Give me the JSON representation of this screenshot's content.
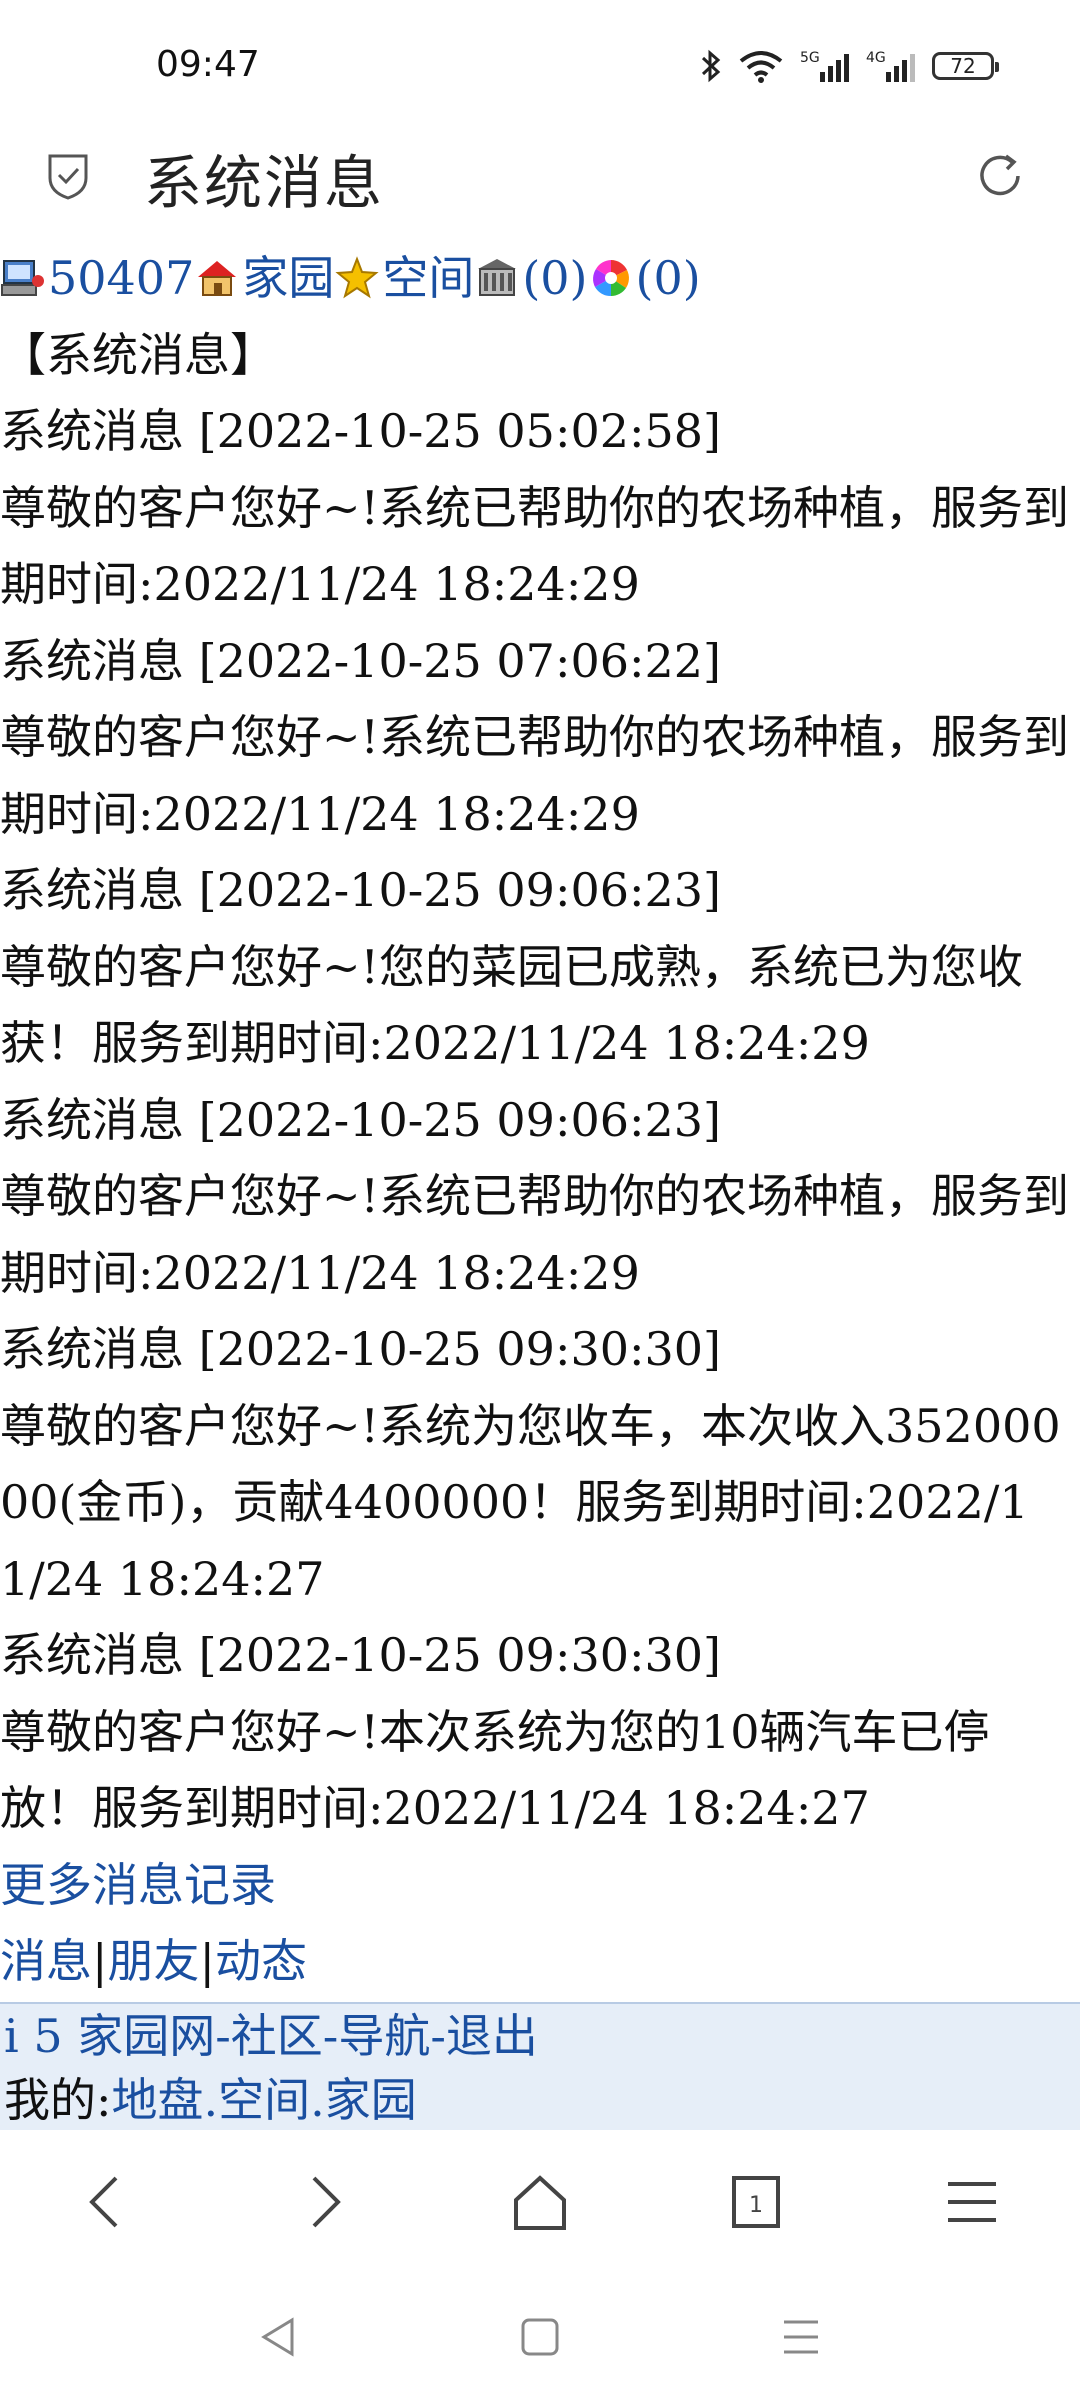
{
  "status_bar": {
    "time": "09:47",
    "battery": "72",
    "network_5g": "5G",
    "network_4g": "4G"
  },
  "app_bar": {
    "title": "系统消息"
  },
  "top_nav": {
    "user_id": "50407",
    "home_label": "家园",
    "space_label": "空间",
    "count_a": "(0)",
    "count_b": "(0)"
  },
  "section_title": "【系统消息】",
  "messages": [
    {
      "header": "系统消息 [2022-10-25 05:02:58]",
      "body": "尊敬的客户您好~!系统已帮助你的农场种植，服务到期时间:2022/11/24 18:24:29"
    },
    {
      "header": "系统消息 [2022-10-25 07:06:22]",
      "body": "尊敬的客户您好~!系统已帮助你的农场种植，服务到期时间:2022/11/24 18:24:29"
    },
    {
      "header": "系统消息 [2022-10-25 09:06:23]",
      "body": "尊敬的客户您好~!您的菜园已成熟，系统已为您收获！服务到期时间:2022/11/24 18:24:29"
    },
    {
      "header": "系统消息 [2022-10-25 09:06:23]",
      "body": "尊敬的客户您好~!系统已帮助你的农场种植，服务到期时间:2022/11/24 18:24:29"
    },
    {
      "header": "系统消息 [2022-10-25 09:30:30]",
      "body": "尊敬的客户您好~!系统为您收车，本次收入35200000(金币)，贡献4400000！服务到期时间:2022/11/24 18:24:27"
    },
    {
      "header": "系统消息 [2022-10-25 09:30:30]",
      "body": "尊敬的客户您好~!本次系统为您的10辆汽车已停放！服务到期时间:2022/11/24 18:24:27"
    }
  ],
  "more_link": "更多消息记录",
  "bottom_links": {
    "messages": "消息",
    "friends": "朋友",
    "activity": "动态",
    "sep": "|"
  },
  "footer": {
    "site": "i 5 家园网",
    "community": "社区",
    "nav": "导航",
    "logout": "退出",
    "dash": "-",
    "mine_label": "我的:",
    "land": "地盘",
    "space": "空间",
    "home": "家园",
    "dot": "."
  },
  "colors": {
    "link": "#1a4fa0",
    "footer_bg": "#e6eef8"
  }
}
